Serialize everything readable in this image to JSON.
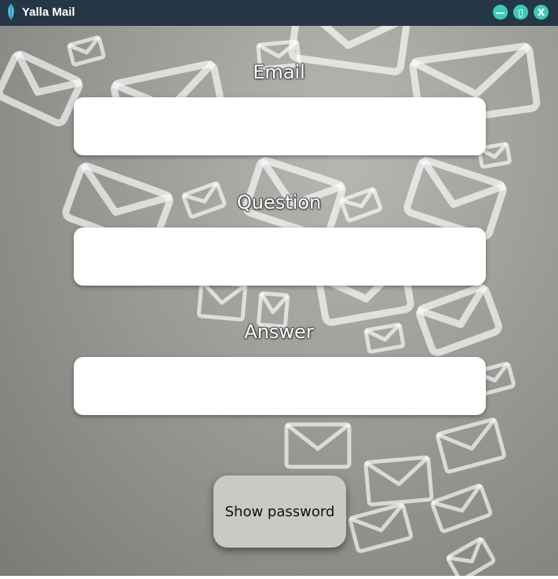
{
  "window": {
    "title": "Yalla Mail",
    "controls": {
      "minimize_glyph": "—",
      "maximize_glyph": "▯",
      "close_glyph": "X"
    }
  },
  "form": {
    "email_label": "Email",
    "email_value": "",
    "question_label": "Question",
    "question_value": "",
    "answer_label": "Answer",
    "answer_value": "",
    "show_password_label": "Show password"
  },
  "colors": {
    "titlebar": "#253746",
    "window_controls": "#3ec9ba",
    "button_bg": "#cbc9c5"
  },
  "icons": {
    "app": "feather-icon",
    "background": "envelope-icon"
  }
}
